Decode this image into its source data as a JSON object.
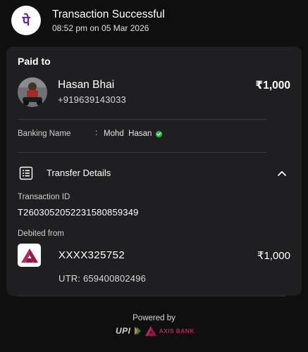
{
  "header": {
    "title": "Transaction Successful",
    "datetime": "08:52 pm on 05 Mar 2026",
    "app_logo_glyph": "पे",
    "brand_color": "#5f259f"
  },
  "payment": {
    "paid_to_label": "Paid to",
    "payee_name": "Hasan Bhai",
    "payee_phone": "+919639143033",
    "amount": "₹1,000"
  },
  "banking": {
    "label": "Banking Name",
    "separator": ":",
    "value": "Mohd  Hasan",
    "verified_color": "#2fb344"
  },
  "transfer": {
    "section_label": "Transfer Details",
    "txn_id_label": "Transaction ID",
    "txn_id": "T2603052052231580859349",
    "debited_label": "Debited from",
    "account": "XXXX325752",
    "account_amount": "₹1,000",
    "utr": "UTR: 659400802496"
  },
  "footer": {
    "powered_by": "Powered by",
    "upi_text": "UPI",
    "bank_text": "AXIS BANK",
    "axis_color": "#ae285d"
  }
}
